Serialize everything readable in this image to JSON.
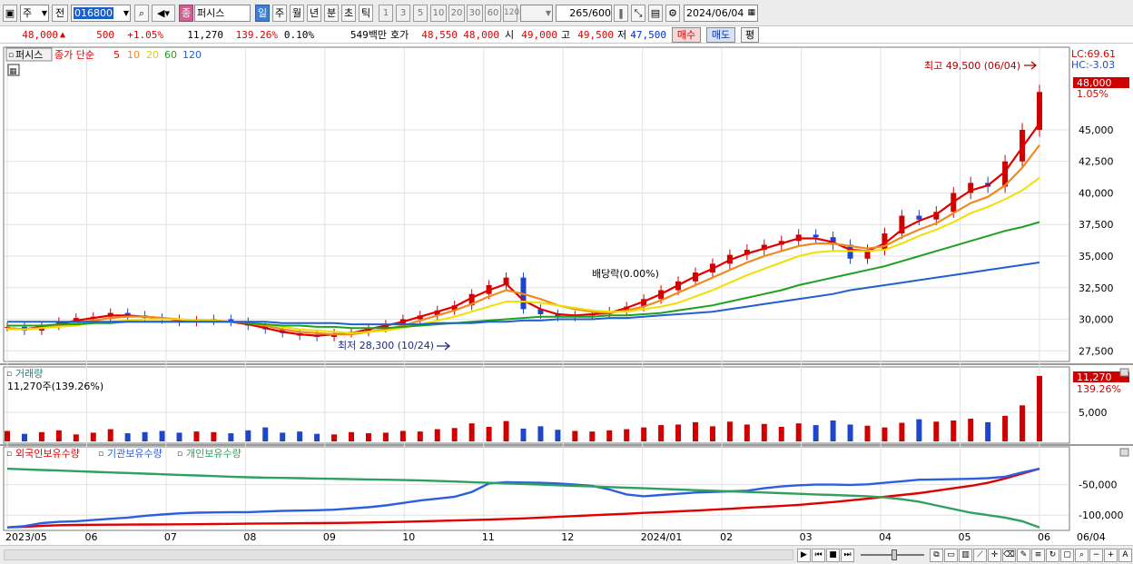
{
  "toolbar": {
    "period_select": "주",
    "prev_label": "전",
    "code_value": "016800",
    "name_badge": "종",
    "stock_name": "퍼시스",
    "periods": [
      "일",
      "주",
      "월",
      "년",
      "분",
      "초",
      "틱"
    ],
    "intervals": [
      "1",
      "3",
      "5",
      "10",
      "20",
      "30",
      "60",
      "120"
    ],
    "count_value": "265",
    "count_total": "/600",
    "date_value": "2024/06/04"
  },
  "quote": {
    "price": "48,000",
    "change": "500",
    "change_pct": "+1.05%",
    "volume": "11,270",
    "volume_ratio": "139.26%",
    "turnover": "0.10%",
    "amount": "549백만",
    "ask_label": "호가",
    "ask": "48,550",
    "bid": "48,000",
    "open_label": "시",
    "open": "49,000",
    "high_label": "고",
    "high": "49,500",
    "low_label": "저",
    "low": "47,500",
    "buy_label": "매수",
    "sell_label": "매도",
    "eval_label": "평"
  },
  "price_panel": {
    "title": "퍼시스",
    "legend": [
      "종가 단순",
      "5",
      "10",
      "20",
      "60",
      "120"
    ],
    "lc": "LC:69.61",
    "hc": "HC:-3.03",
    "cur_price": "48,000",
    "cur_pct": "1.05%",
    "max_note": "최고 49,500 (06/04)",
    "min_note": "최저 28,300 (10/24)",
    "dividend_note": "배당락(0.00%)"
  },
  "volume_panel": {
    "title": "거래량",
    "subtitle": "11,270주(139.26%)",
    "cur_value": "11,270",
    "cur_pct": "139.26%"
  },
  "holding_panel": {
    "legend": [
      "외국인보유수량",
      "기관보유수량",
      "개인보유수량"
    ]
  },
  "colors": {
    "up": "#d00000",
    "down": "#2045c8",
    "ma5": "#e00000",
    "ma10": "#f08a20",
    "ma20": "#f0e000",
    "ma60": "#20a020",
    "ma120": "#2060d0",
    "foreign": "#e00000",
    "institution": "#2a5fe0",
    "individual": "#30a060"
  },
  "chart_data": [
    {
      "type": "line",
      "title": "퍼시스",
      "x_ticks": [
        "2023/05",
        "06",
        "07",
        "08",
        "09",
        "10",
        "11",
        "12",
        "2024/01",
        "02",
        "03",
        "04",
        "05",
        "06"
      ],
      "yticks": [
        27500,
        30000,
        32500,
        35000,
        37500,
        40000,
        42500,
        45000
      ],
      "ylim": [
        26800,
        51400
      ],
      "series": [
        {
          "name": "종가",
          "values": [
            29400,
            29100,
            29500,
            29800,
            30100,
            30200,
            30500,
            30300,
            30100,
            30000,
            29800,
            29900,
            30000,
            29800,
            29500,
            29200,
            28900,
            28700,
            28600,
            28900,
            29000,
            29300,
            29600,
            30000,
            30300,
            30700,
            31100,
            32000,
            32700,
            33300,
            30800,
            30400,
            30200,
            30300,
            30400,
            30600,
            31000,
            31600,
            32300,
            33000,
            33700,
            34400,
            35100,
            35500,
            35900,
            36200,
            36700,
            36500,
            35900,
            34800,
            35500,
            36800,
            38200,
            37900,
            38500,
            40000,
            40800,
            40500,
            42500,
            45000,
            48000
          ]
        },
        {
          "name": "5",
          "values": [
            29300,
            29200,
            29400,
            29600,
            29900,
            30100,
            30300,
            30300,
            30200,
            30100,
            29900,
            29900,
            29900,
            29800,
            29600,
            29300,
            29000,
            28800,
            28700,
            28800,
            28900,
            29200,
            29500,
            29800,
            30200,
            30600,
            31000,
            31700,
            32300,
            32800,
            31500,
            30800,
            30400,
            30300,
            30400,
            30500,
            30900,
            31400,
            32000,
            32700,
            33400,
            34000,
            34700,
            35200,
            35600,
            36000,
            36400,
            36400,
            36100,
            35500,
            35400,
            36000,
            37100,
            37800,
            38300,
            39300,
            40200,
            40600,
            41700,
            43600,
            45500
          ]
        },
        {
          "name": "10",
          "values": [
            29300,
            29200,
            29300,
            29500,
            29700,
            29900,
            30100,
            30200,
            30200,
            30100,
            30000,
            29900,
            29900,
            29800,
            29700,
            29500,
            29200,
            29000,
            28900,
            28800,
            28800,
            29000,
            29200,
            29500,
            29900,
            30300,
            30700,
            31200,
            31800,
            32300,
            32000,
            31600,
            31100,
            30800,
            30600,
            30500,
            30700,
            31000,
            31500,
            32100,
            32700,
            33300,
            33900,
            34500,
            35000,
            35400,
            35800,
            36000,
            36000,
            35800,
            35600,
            35800,
            36500,
            37100,
            37600,
            38400,
            39200,
            39700,
            40600,
            42000,
            43800
          ]
        },
        {
          "name": "20",
          "values": [
            29200,
            29200,
            29300,
            29400,
            29500,
            29700,
            29800,
            29900,
            30000,
            30000,
            30000,
            29900,
            29900,
            29800,
            29800,
            29600,
            29400,
            29200,
            29100,
            29000,
            28900,
            29000,
            29100,
            29300,
            29600,
            29900,
            30200,
            30600,
            31000,
            31400,
            31400,
            31300,
            31100,
            30900,
            30700,
            30600,
            30600,
            30800,
            31000,
            31300,
            31800,
            32300,
            32900,
            33500,
            34000,
            34500,
            35000,
            35300,
            35400,
            35400,
            35400,
            35500,
            36000,
            36600,
            37100,
            37700,
            38400,
            38900,
            39500,
            40200,
            41200
          ]
        },
        {
          "name": "60",
          "values": [
            29500,
            29500,
            29500,
            29600,
            29600,
            29700,
            29700,
            29800,
            29800,
            29800,
            29800,
            29800,
            29800,
            29800,
            29700,
            29600,
            29500,
            29500,
            29400,
            29400,
            29300,
            29300,
            29300,
            29400,
            29500,
            29600,
            29700,
            29800,
            29900,
            30000,
            30100,
            30200,
            30200,
            30200,
            30200,
            30300,
            30300,
            30400,
            30500,
            30700,
            30900,
            31100,
            31400,
            31700,
            32000,
            32300,
            32700,
            33000,
            33300,
            33600,
            33900,
            34200,
            34600,
            35000,
            35400,
            35800,
            36200,
            36600,
            37000,
            37300,
            37700
          ]
        },
        {
          "name": "120",
          "values": [
            29800,
            29800,
            29800,
            29800,
            29800,
            29800,
            29800,
            29800,
            29800,
            29800,
            29800,
            29800,
            29800,
            29800,
            29800,
            29800,
            29700,
            29700,
            29700,
            29700,
            29600,
            29600,
            29600,
            29600,
            29600,
            29700,
            29700,
            29700,
            29800,
            29800,
            29900,
            29900,
            30000,
            30000,
            30000,
            30100,
            30100,
            30200,
            30300,
            30400,
            30500,
            30600,
            30800,
            31000,
            31200,
            31400,
            31600,
            31800,
            32000,
            32300,
            32500,
            32700,
            32900,
            33100,
            33300,
            33500,
            33700,
            33900,
            34100,
            34300,
            34500
          ]
        }
      ]
    },
    {
      "type": "bar",
      "title": "거래량",
      "yticks": [
        5000
      ],
      "ylim": [
        0,
        12500
      ],
      "series": [
        {
          "name": "거래량",
          "values": [
            1800,
            1300,
            1600,
            1900,
            1200,
            1500,
            2100,
            1400,
            1600,
            1800,
            1500,
            1700,
            1600,
            1400,
            1900,
            2400,
            1500,
            1700,
            1300,
            1200,
            1600,
            1400,
            1500,
            1800,
            1700,
            2100,
            2300,
            3100,
            2500,
            3500,
            2200,
            2600,
            2000,
            1800,
            1700,
            1900,
            2100,
            2400,
            2800,
            2900,
            3300,
            2600,
            3400,
            2900,
            3000,
            2500,
            3100,
            2800,
            3600,
            2900,
            2700,
            2400,
            3200,
            3800,
            3400,
            3600,
            3900,
            3300,
            4400,
            6200,
            11270
          ]
        }
      ]
    },
    {
      "type": "line",
      "yticks": [
        -50000,
        -100000
      ],
      "ylim": [
        -122000,
        0
      ],
      "series": [
        {
          "name": "외국인보유수량",
          "values": [
            -120000,
            -119000,
            -117500,
            -116500,
            -116000,
            -115800,
            -115600,
            -115400,
            -115300,
            -115100,
            -115000,
            -114800,
            -114500,
            -114200,
            -114000,
            -113700,
            -113500,
            -113200,
            -113000,
            -112800,
            -112500,
            -112000,
            -111500,
            -111000,
            -110300,
            -109500,
            -108800,
            -108000,
            -107200,
            -106300,
            -105300,
            -104000,
            -102800,
            -101500,
            -100200,
            -99000,
            -97700,
            -96300,
            -95000,
            -93800,
            -92500,
            -91000,
            -89500,
            -88000,
            -86500,
            -85000,
            -83200,
            -80800,
            -78600,
            -75800,
            -73000,
            -70000,
            -67000,
            -64000,
            -60000,
            -56000,
            -52000,
            -47000,
            -40000,
            -32000,
            -24000
          ]
        },
        {
          "name": "기관보유수량",
          "values": [
            -120000,
            -118000,
            -113000,
            -111000,
            -110000,
            -108000,
            -106000,
            -104000,
            -101000,
            -99000,
            -97000,
            -96000,
            -95500,
            -95000,
            -95000,
            -94000,
            -93000,
            -92500,
            -92000,
            -91000,
            -89000,
            -87000,
            -84000,
            -80000,
            -76000,
            -73000,
            -70000,
            -62000,
            -48000,
            -46000,
            -46500,
            -47000,
            -48000,
            -50000,
            -52000,
            -58000,
            -66000,
            -69000,
            -67000,
            -65000,
            -63000,
            -62000,
            -61000,
            -60000,
            -56000,
            -53000,
            -51000,
            -50000,
            -50000,
            -50500,
            -49500,
            -47000,
            -44500,
            -42000,
            -41500,
            -41000,
            -40500,
            -39500,
            -37000,
            -30000,
            -24000
          ]
        },
        {
          "name": "개인보유수량",
          "values": [
            -24000,
            -25000,
            -26000,
            -27000,
            -28000,
            -29000,
            -30000,
            -31000,
            -32000,
            -33000,
            -34000,
            -35000,
            -36000,
            -37000,
            -38000,
            -38500,
            -39000,
            -39500,
            -40000,
            -40500,
            -41000,
            -41500,
            -42000,
            -42500,
            -43000,
            -44000,
            -45000,
            -46000,
            -47000,
            -48000,
            -49000,
            -50000,
            -51000,
            -52000,
            -53000,
            -54000,
            -55000,
            -56000,
            -57000,
            -58000,
            -59000,
            -60000,
            -61000,
            -62000,
            -63000,
            -64000,
            -65000,
            -66000,
            -67000,
            -68000,
            -69000,
            -71000,
            -74000,
            -78000,
            -84000,
            -90000,
            -96000,
            -100000,
            -104000,
            -110000,
            -120000
          ]
        }
      ]
    }
  ],
  "x_axis": {
    "labels": [
      "2023/05",
      "06",
      "07",
      "08",
      "09",
      "10",
      "11",
      "12",
      "2024/01",
      "02",
      "03",
      "04",
      "05",
      "06"
    ],
    "end_label": "06/04"
  }
}
